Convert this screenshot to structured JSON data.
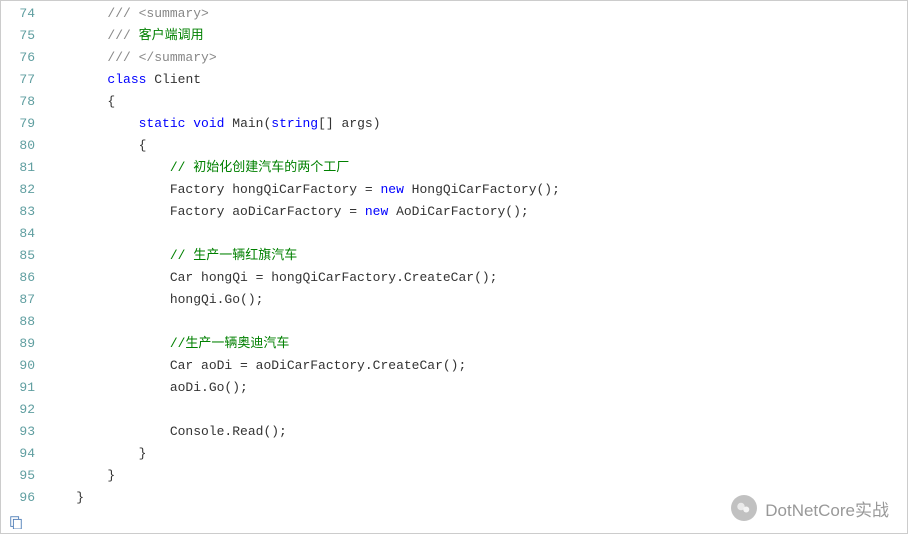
{
  "code": {
    "lines": [
      {
        "num": 74,
        "indent": "        ",
        "tokens": [
          {
            "cls": "comment-gray",
            "t": "/// <summary>"
          }
        ]
      },
      {
        "num": 75,
        "indent": "        ",
        "tokens": [
          {
            "cls": "comment-gray",
            "t": "/// "
          },
          {
            "cls": "comment-green",
            "t": "客户端调用"
          }
        ]
      },
      {
        "num": 76,
        "indent": "        ",
        "tokens": [
          {
            "cls": "comment-gray",
            "t": "/// </summary>"
          }
        ]
      },
      {
        "num": 77,
        "indent": "        ",
        "tokens": [
          {
            "cls": "keyword",
            "t": "class"
          },
          {
            "cls": "",
            "t": " Client"
          }
        ]
      },
      {
        "num": 78,
        "indent": "        ",
        "tokens": [
          {
            "cls": "",
            "t": "{"
          }
        ]
      },
      {
        "num": 79,
        "indent": "            ",
        "tokens": [
          {
            "cls": "keyword",
            "t": "static"
          },
          {
            "cls": "",
            "t": " "
          },
          {
            "cls": "keyword",
            "t": "void"
          },
          {
            "cls": "",
            "t": " Main("
          },
          {
            "cls": "keyword",
            "t": "string"
          },
          {
            "cls": "",
            "t": "[] args)"
          }
        ]
      },
      {
        "num": 80,
        "indent": "            ",
        "tokens": [
          {
            "cls": "",
            "t": "{"
          }
        ]
      },
      {
        "num": 81,
        "indent": "                ",
        "tokens": [
          {
            "cls": "comment-green",
            "t": "// 初始化创建汽车的两个工厂"
          }
        ]
      },
      {
        "num": 82,
        "indent": "                ",
        "tokens": [
          {
            "cls": "",
            "t": "Factory hongQiCarFactory = "
          },
          {
            "cls": "keyword",
            "t": "new"
          },
          {
            "cls": "",
            "t": " HongQiCarFactory();"
          }
        ]
      },
      {
        "num": 83,
        "indent": "                ",
        "tokens": [
          {
            "cls": "",
            "t": "Factory aoDiCarFactory = "
          },
          {
            "cls": "keyword",
            "t": "new"
          },
          {
            "cls": "",
            "t": " AoDiCarFactory();"
          }
        ]
      },
      {
        "num": 84,
        "indent": "",
        "tokens": []
      },
      {
        "num": 85,
        "indent": "                ",
        "tokens": [
          {
            "cls": "comment-green",
            "t": "// 生产一辆红旗汽车"
          }
        ]
      },
      {
        "num": 86,
        "indent": "                ",
        "tokens": [
          {
            "cls": "",
            "t": "Car hongQi = hongQiCarFactory.CreateCar();"
          }
        ]
      },
      {
        "num": 87,
        "indent": "                ",
        "tokens": [
          {
            "cls": "",
            "t": "hongQi.Go();"
          }
        ]
      },
      {
        "num": 88,
        "indent": "",
        "tokens": []
      },
      {
        "num": 89,
        "indent": "                ",
        "tokens": [
          {
            "cls": "comment-green",
            "t": "//生产一辆奥迪汽车"
          }
        ]
      },
      {
        "num": 90,
        "indent": "                ",
        "tokens": [
          {
            "cls": "",
            "t": "Car aoDi = aoDiCarFactory.CreateCar();"
          }
        ]
      },
      {
        "num": 91,
        "indent": "                ",
        "tokens": [
          {
            "cls": "",
            "t": "aoDi.Go();"
          }
        ]
      },
      {
        "num": 92,
        "indent": "",
        "tokens": []
      },
      {
        "num": 93,
        "indent": "                ",
        "tokens": [
          {
            "cls": "",
            "t": "Console.Read();"
          }
        ]
      },
      {
        "num": 94,
        "indent": "            ",
        "tokens": [
          {
            "cls": "",
            "t": "}"
          }
        ]
      },
      {
        "num": 95,
        "indent": "        ",
        "tokens": [
          {
            "cls": "",
            "t": "}"
          }
        ]
      },
      {
        "num": 96,
        "indent": "    ",
        "tokens": [
          {
            "cls": "",
            "t": "}"
          }
        ]
      }
    ]
  },
  "watermark": {
    "text": "DotNetCore实战"
  }
}
